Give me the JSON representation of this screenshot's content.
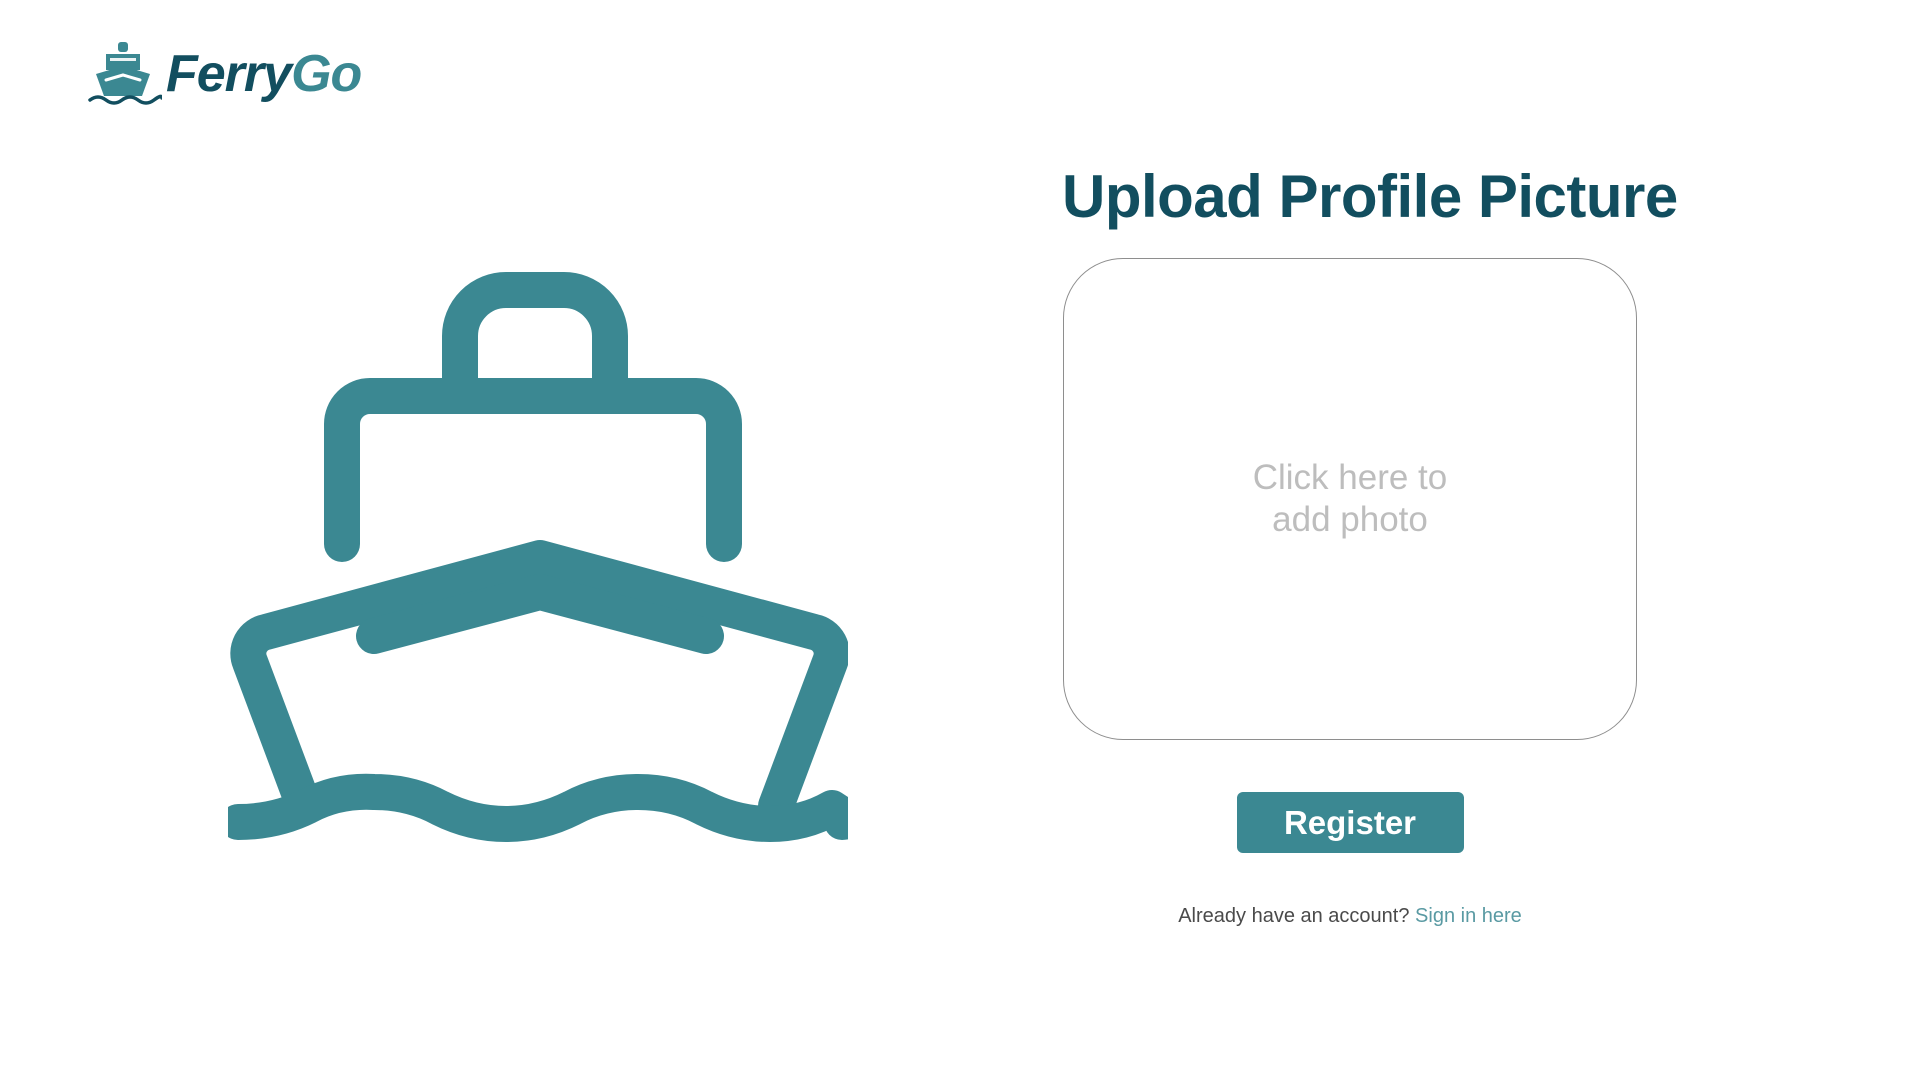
{
  "brand": {
    "name_part1": "Ferry",
    "name_part2": "Go",
    "logo_icon": "ferry-icon",
    "primary_color": "#124e5f",
    "accent_color": "#3b8892"
  },
  "hero": {
    "icon": "ferry-boat-illustration",
    "color": "#3b8892"
  },
  "upload": {
    "title": "Upload Profile Picture",
    "placeholder": "Click here to add photo"
  },
  "actions": {
    "register_label": "Register"
  },
  "footer": {
    "prompt": "Already have an account?",
    "link_label": "Sign in here",
    "link_color": "#5a9aa3"
  }
}
